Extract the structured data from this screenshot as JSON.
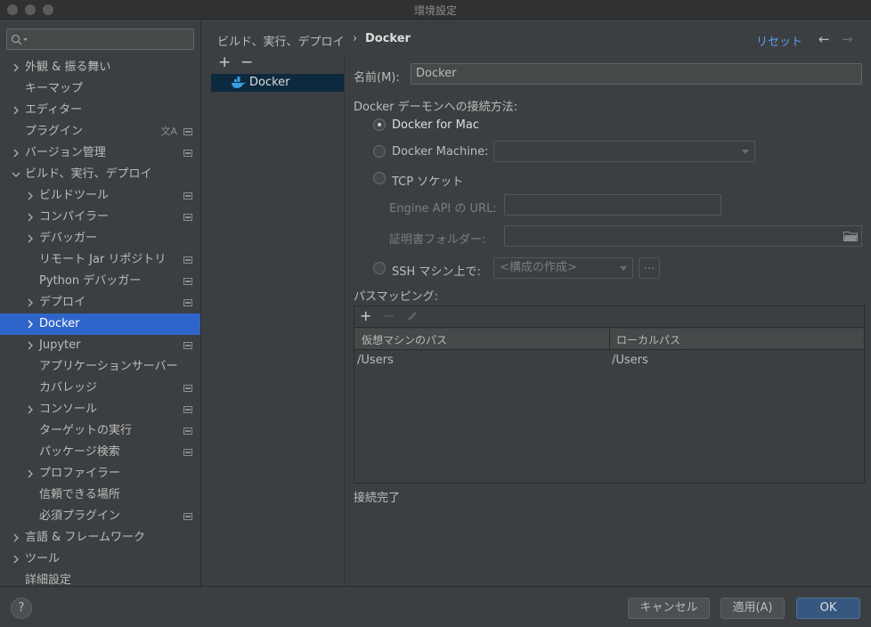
{
  "window": {
    "title": "環境設定"
  },
  "search": {
    "placeholder": ""
  },
  "tree": [
    {
      "label": "外観 & 振る舞い",
      "expandable": true,
      "expanded": false,
      "level": 0,
      "project": false
    },
    {
      "label": "キーマップ",
      "expandable": false,
      "level": 0,
      "project": false
    },
    {
      "label": "エディター",
      "expandable": true,
      "expanded": false,
      "level": 0,
      "project": false
    },
    {
      "label": "プラグイン",
      "expandable": false,
      "level": 0,
      "project": true,
      "lang": true
    },
    {
      "label": "バージョン管理",
      "expandable": true,
      "expanded": false,
      "level": 0,
      "project": true
    },
    {
      "label": "ビルド、実行、デプロイ",
      "expandable": true,
      "expanded": true,
      "level": 0,
      "project": false
    },
    {
      "label": "ビルドツール",
      "expandable": true,
      "expanded": false,
      "level": 1,
      "project": true
    },
    {
      "label": "コンパイラー",
      "expandable": true,
      "expanded": false,
      "level": 1,
      "project": true
    },
    {
      "label": "デバッガー",
      "expandable": true,
      "expanded": false,
      "level": 1,
      "project": false
    },
    {
      "label": "リモート Jar リポジトリ",
      "expandable": false,
      "level": 1,
      "project": true
    },
    {
      "label": "Python デバッガー",
      "expandable": false,
      "level": 1,
      "project": true
    },
    {
      "label": "デプロイ",
      "expandable": true,
      "expanded": false,
      "level": 1,
      "project": true
    },
    {
      "label": "Docker",
      "expandable": true,
      "expanded": false,
      "level": 1,
      "project": false,
      "selected": true
    },
    {
      "label": "Jupyter",
      "expandable": true,
      "expanded": false,
      "level": 1,
      "project": true
    },
    {
      "label": "アプリケーションサーバー",
      "expandable": false,
      "level": 1,
      "project": false
    },
    {
      "label": "カバレッジ",
      "expandable": false,
      "level": 1,
      "project": true
    },
    {
      "label": "コンソール",
      "expandable": true,
      "expanded": false,
      "level": 1,
      "project": true
    },
    {
      "label": "ターゲットの実行",
      "expandable": false,
      "level": 1,
      "project": true
    },
    {
      "label": "パッケージ検索",
      "expandable": false,
      "level": 1,
      "project": true
    },
    {
      "label": "プロファイラー",
      "expandable": true,
      "expanded": false,
      "level": 1,
      "project": false
    },
    {
      "label": "信頼できる場所",
      "expandable": false,
      "level": 1,
      "project": false
    },
    {
      "label": "必須プラグイン",
      "expandable": false,
      "level": 1,
      "project": true
    },
    {
      "label": "言語 & フレームワーク",
      "expandable": true,
      "expanded": false,
      "level": 0,
      "project": false
    },
    {
      "label": "ツール",
      "expandable": true,
      "expanded": false,
      "level": 0,
      "project": false
    },
    {
      "label": "詳細設定",
      "expandable": false,
      "level": 0,
      "project": false
    }
  ],
  "header": {
    "breadcrumb_parent": "ビルド、実行、デプロイ",
    "breadcrumb_sep": "›",
    "breadcrumb_current": "Docker",
    "reset": "リセット",
    "back": "←",
    "forward": "→"
  },
  "midlist": {
    "add": "+",
    "remove": "−",
    "item": "Docker"
  },
  "form": {
    "name_label": "名前(M):",
    "name_value": "Docker",
    "connect_label": "Docker デーモンへの接続方法:",
    "radio_mac": "Docker for Mac",
    "radio_machine": "Docker Machine:",
    "radio_tcp": "TCP ソケット",
    "engine_label": "Engine API の URL:",
    "cert_label": "証明書フォルダー:",
    "radio_ssh": "SSH マシン上で:",
    "ssh_select": "<構成の作成>",
    "dots": "...",
    "path_label": "パスマッピング:",
    "status": "接続完了",
    "selected_radio": "Docker for Mac"
  },
  "table": {
    "add": "+",
    "remove": "−",
    "columns": [
      "仮想マシンのパス",
      "ローカルパス"
    ],
    "rows": [
      [
        "/Users",
        "/Users"
      ]
    ]
  },
  "footer": {
    "help": "?",
    "cancel": "キャンセル",
    "apply": "適用(A)",
    "ok": "OK"
  }
}
